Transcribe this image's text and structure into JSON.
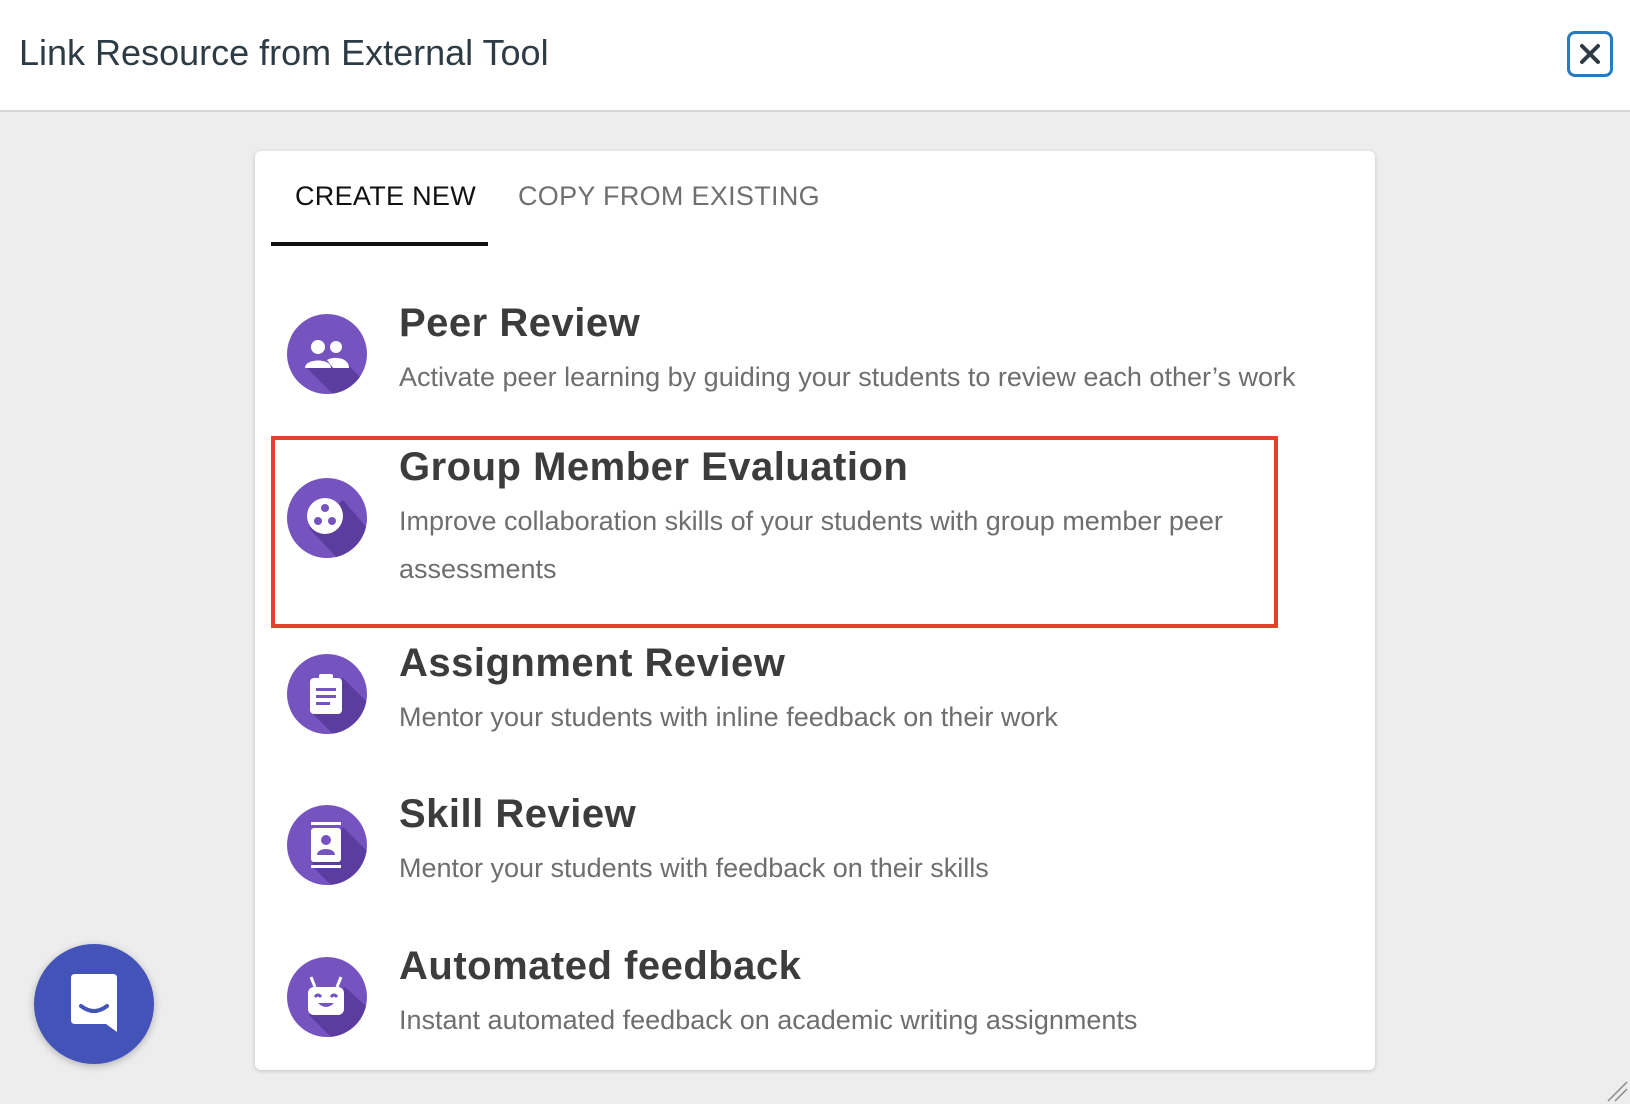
{
  "dialog": {
    "title": "Link Resource from External Tool",
    "close_icon": "close-icon"
  },
  "tabs": [
    {
      "label": "CREATE NEW",
      "active": true
    },
    {
      "label": "COPY FROM EXISTING",
      "active": false
    }
  ],
  "tools": [
    {
      "title": "Peer Review",
      "description": "Activate peer learning by guiding your students to review each other’s work",
      "icon": "people-icon"
    },
    {
      "title": "Group Member Evaluation",
      "description": "Improve collaboration skills of your students with group member peer assessments",
      "icon": "group-circle-icon",
      "highlighted": true
    },
    {
      "title": "Assignment Review",
      "description": "Mentor your students with inline feedback on their work",
      "icon": "clipboard-icon"
    },
    {
      "title": "Skill Review",
      "description": "Mentor your students with feedback on their skills",
      "icon": "contact-card-icon"
    },
    {
      "title": "Automated feedback",
      "description": "Instant automated feedback on academic writing assignments",
      "icon": "robot-icon"
    }
  ],
  "colors": {
    "icon_bg": "#7554bf",
    "icon_shadow": "#5a3d9e",
    "highlight": "#e2412a",
    "close_border": "#2b7abc",
    "chat_launcher": "#4353b8"
  },
  "chat_launcher": {
    "icon": "chat-icon"
  }
}
